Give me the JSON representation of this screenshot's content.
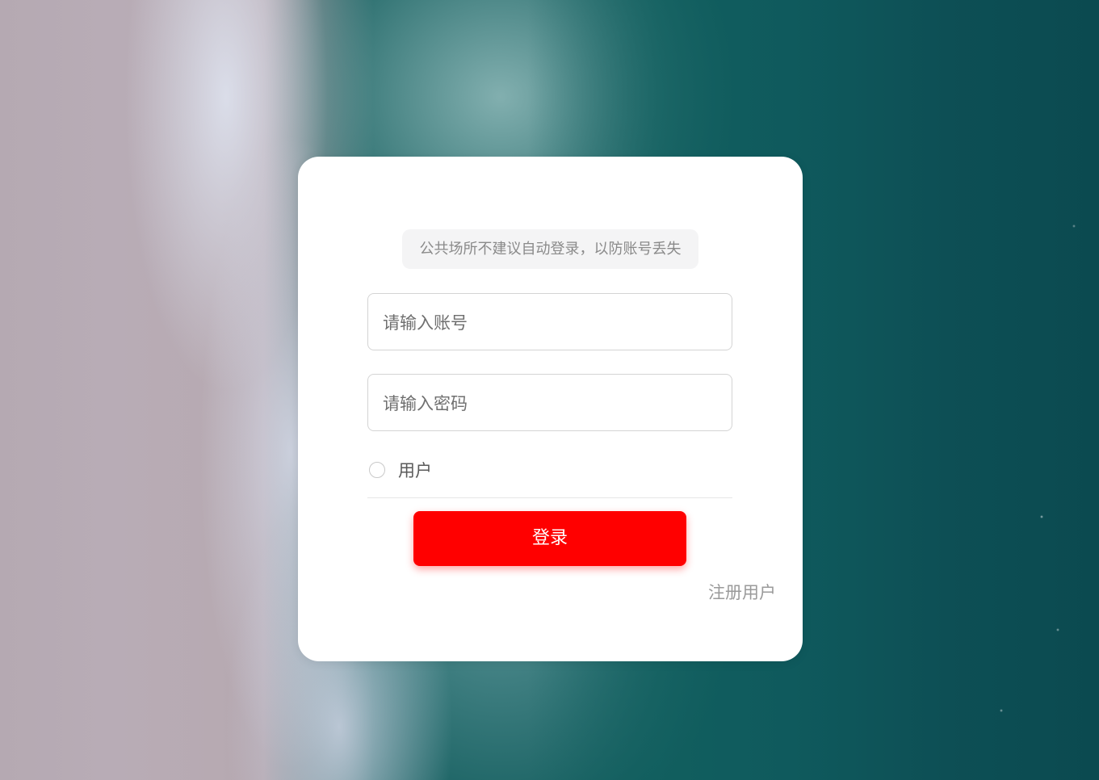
{
  "login": {
    "notice": "公共场所不建议自动登录，以防账号丢失",
    "account_placeholder": "请输入账号",
    "password_placeholder": "请输入密码",
    "role_option": "用户",
    "login_button": "登录",
    "register_link": "注册用户"
  },
  "colors": {
    "accent": "#ff0000",
    "card_background": "#ffffff"
  }
}
